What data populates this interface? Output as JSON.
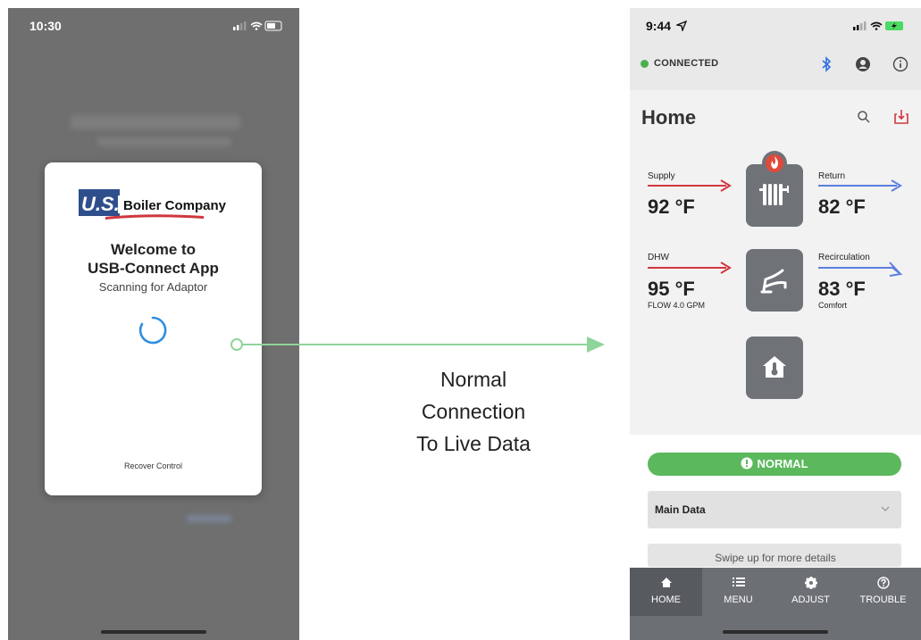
{
  "left_phone": {
    "status_time": "10:30",
    "logo_text": "U.S. Boiler Company",
    "welcome_line1": "Welcome to",
    "welcome_line2": "USB-Connect App",
    "scanning_text": "Scanning for Adaptor",
    "recover_link": "Recover Control"
  },
  "caption": {
    "line1": "Normal",
    "line2": "Connection",
    "line3": "To Live Data"
  },
  "right_phone": {
    "status_time": "9:44",
    "connection_status": "CONNECTED",
    "page_title": "Home",
    "supply": {
      "label": "Supply",
      "value": "92 °F"
    },
    "return": {
      "label": "Return",
      "value": "82 °F"
    },
    "dhw": {
      "label": "DHW",
      "value": "95 °F",
      "flow": "FLOW 4.0 GPM"
    },
    "recirculation": {
      "label": "Recirculation",
      "value": "83 °F",
      "mode": "Comfort"
    },
    "status_pill": "NORMAL",
    "main_data_label": "Main Data",
    "swipe_hint": "Swipe up for more details",
    "tabs": [
      {
        "label": "HOME",
        "icon": "home-icon"
      },
      {
        "label": "MENU",
        "icon": "list-icon"
      },
      {
        "label": "ADJUST",
        "icon": "gear-icon"
      },
      {
        "label": "TROUBLE",
        "icon": "help-icon"
      }
    ]
  },
  "colors": {
    "connected_green": "#4cae4c",
    "normal_green": "#5cb85c",
    "supply_red": "#d0373f",
    "return_blue": "#5b7fe0",
    "connector_green": "#8fd49a",
    "tile_gray": "#6f7378",
    "flame_red": "#e04a3a",
    "spinner_blue": "#2f8ee0"
  }
}
